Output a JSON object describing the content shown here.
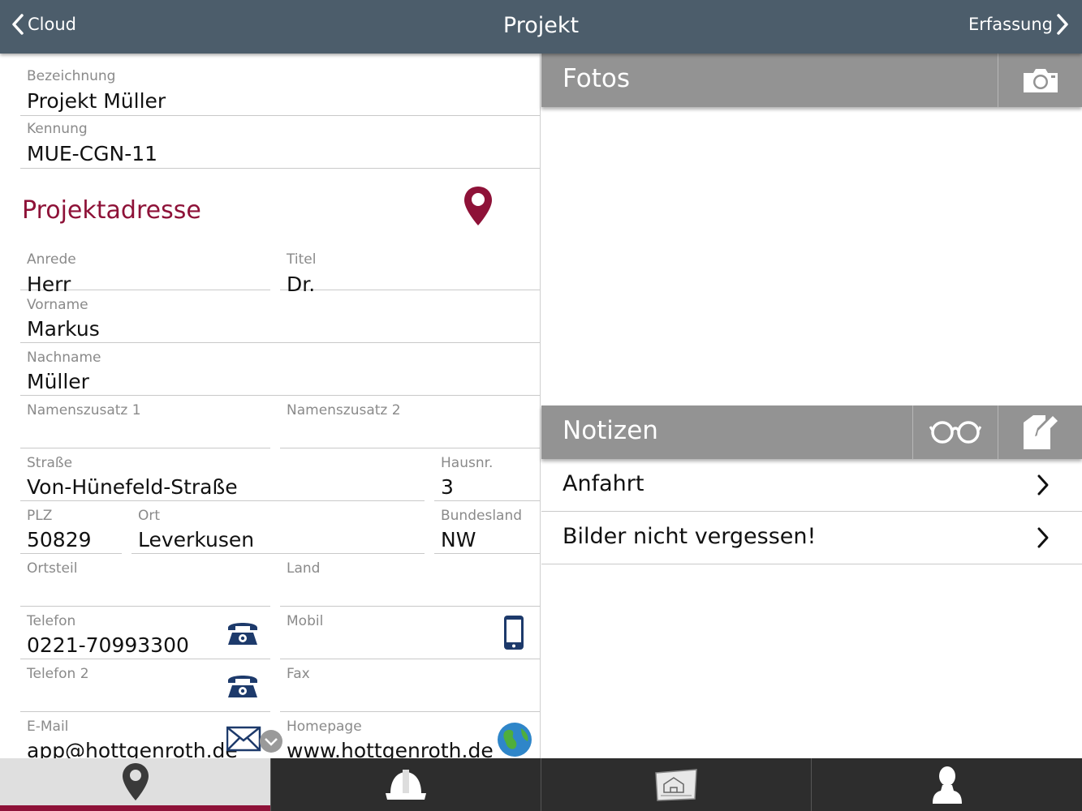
{
  "nav": {
    "back_label": "Cloud",
    "title": "Projekt",
    "forward_label": "Erfassung"
  },
  "project": {
    "bezeichnung_label": "Bezeichnung",
    "bezeichnung_value": "Projekt Müller",
    "kennung_label": "Kennung",
    "kennung_value": "MUE-CGN-11"
  },
  "address": {
    "section_title": "Projektadresse",
    "anrede_label": "Anrede",
    "anrede_value": "Herr",
    "titel_label": "Titel",
    "titel_value": "Dr.",
    "vorname_label": "Vorname",
    "vorname_value": "Markus",
    "nachname_label": "Nachname",
    "nachname_value": "Müller",
    "zusatz1_label": "Namenszusatz 1",
    "zusatz1_value": "",
    "zusatz2_label": "Namenszusatz 2",
    "zusatz2_value": "",
    "strasse_label": "Straße",
    "strasse_value": "Von-Hünefeld-Straße",
    "hausnr_label": "Hausnr.",
    "hausnr_value": "3",
    "plz_label": "PLZ",
    "plz_value": "50829",
    "ort_label": "Ort",
    "ort_value": "Leverkusen",
    "bundesland_label": "Bundesland",
    "bundesland_value": "NW",
    "ortsteil_label": "Ortsteil",
    "ortsteil_value": "",
    "land_label": "Land",
    "land_value": "",
    "telefon_label": "Telefon",
    "telefon_value": "0221-70993300",
    "mobil_label": "Mobil",
    "mobil_value": "",
    "telefon2_label": "Telefon 2",
    "telefon2_value": "",
    "fax_label": "Fax",
    "fax_value": "",
    "email_label": "E-Mail",
    "email_value": "app@hottgenroth.de",
    "homepage_label": "Homepage",
    "homepage_value": "www.hottgenroth.de"
  },
  "photos": {
    "title": "Fotos"
  },
  "notes": {
    "title": "Notizen",
    "items": [
      {
        "label": "Anfahrt"
      },
      {
        "label": "Bilder nicht vergessen!"
      }
    ]
  },
  "tabs": [
    {
      "icon": "location-pin-icon",
      "active": true
    },
    {
      "icon": "hard-hat-icon",
      "active": false
    },
    {
      "icon": "building-plan-icon",
      "active": false
    },
    {
      "icon": "person-icon",
      "active": false
    }
  ],
  "colors": {
    "topbar": "#4c5d6b",
    "accent": "#8e1238",
    "section_header": "#939393",
    "tabbar": "#2d2d2d",
    "icon_blue": "#1d3a6b"
  }
}
